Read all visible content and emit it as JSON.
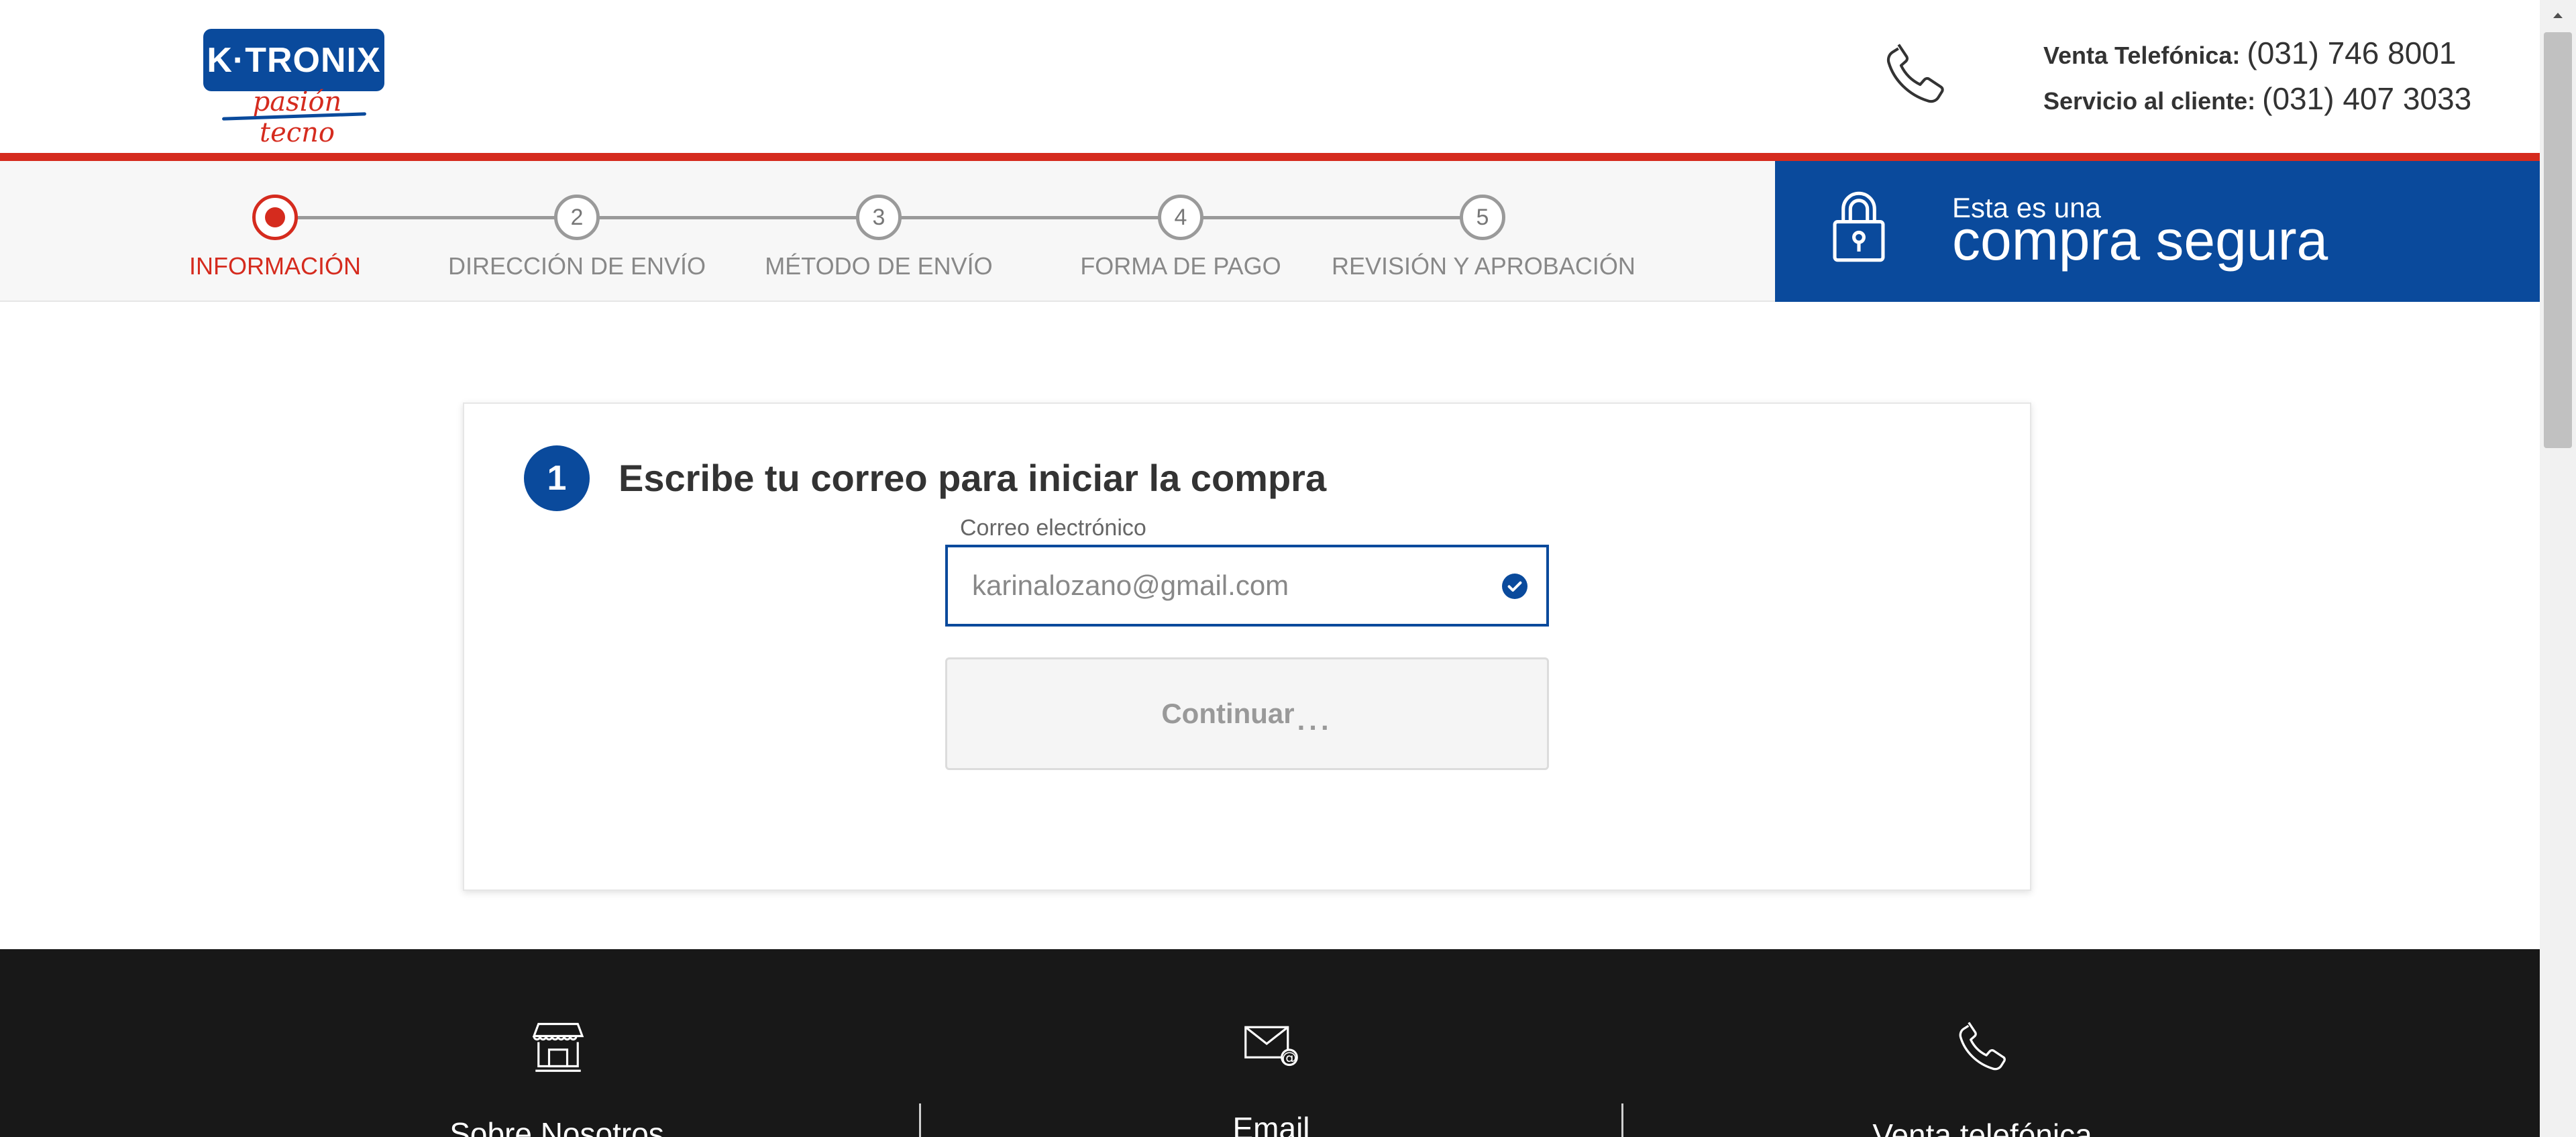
{
  "header": {
    "logo_text": "K·TRONIX",
    "logo_tagline": "pasión tecno",
    "phone_icon": "phone-icon",
    "sales_label": "Venta Telefónica:",
    "sales_number": "(031) 746 8001",
    "service_label": "Servicio al cliente:",
    "service_number": "(031) 407 3033"
  },
  "steps": [
    {
      "number": "1",
      "label": "INFORMACIÓN",
      "active": true
    },
    {
      "number": "2",
      "label": "DIRECCIÓN DE ENVÍO",
      "active": false
    },
    {
      "number": "3",
      "label": "MÉTODO DE ENVÍO",
      "active": false
    },
    {
      "number": "4",
      "label": "FORMA DE PAGO",
      "active": false
    },
    {
      "number": "5",
      "label": "REVISIÓN Y APROBACIÓN",
      "active": false
    }
  ],
  "secure": {
    "icon": "lock-icon",
    "small": "Esta es una",
    "big": "compra segura"
  },
  "form": {
    "step_number": "1",
    "title": "Escribe tu correo para iniciar la compra",
    "email_label": "Correo electrónico",
    "email_value": "karinalozano@gmail.com",
    "continue_label": "Continuar",
    "loading_dots": "..."
  },
  "footer": {
    "items": [
      {
        "icon": "store-icon",
        "label": "Sobre Nosotros"
      },
      {
        "icon": "email-icon",
        "label": "Email"
      },
      {
        "icon": "phone-icon",
        "label": "Venta telefónica"
      }
    ]
  },
  "colors": {
    "brand_blue": "#0a4a9c",
    "brand_red": "#d52b1e",
    "footer_bg": "#181818"
  }
}
